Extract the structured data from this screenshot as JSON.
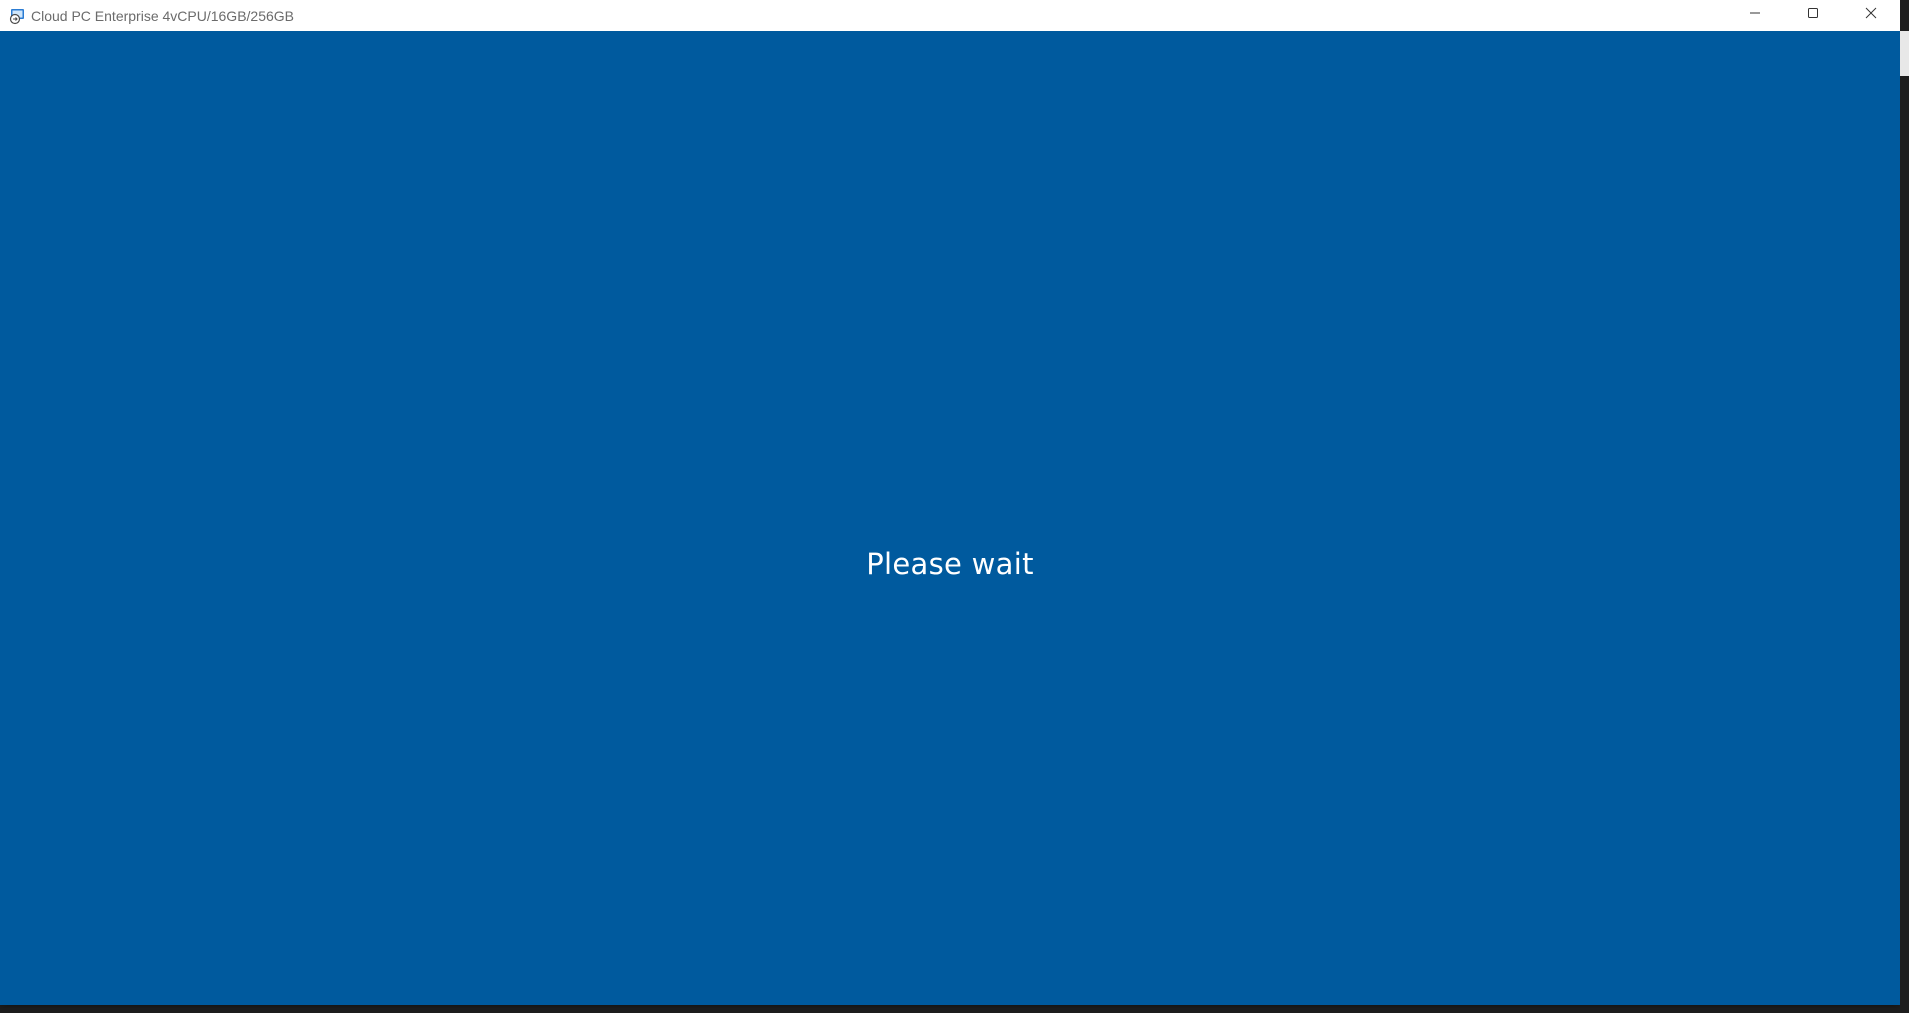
{
  "window": {
    "title": "Cloud PC Enterprise 4vCPU/16GB/256GB",
    "icon": "remote-desktop-icon",
    "controls": {
      "minimize_icon": "minimize-icon",
      "maximize_icon": "maximize-icon",
      "close_icon": "close-icon"
    }
  },
  "content": {
    "status_text": "Please wait",
    "background_color": "#005a9e",
    "text_color": "#ffffff"
  }
}
